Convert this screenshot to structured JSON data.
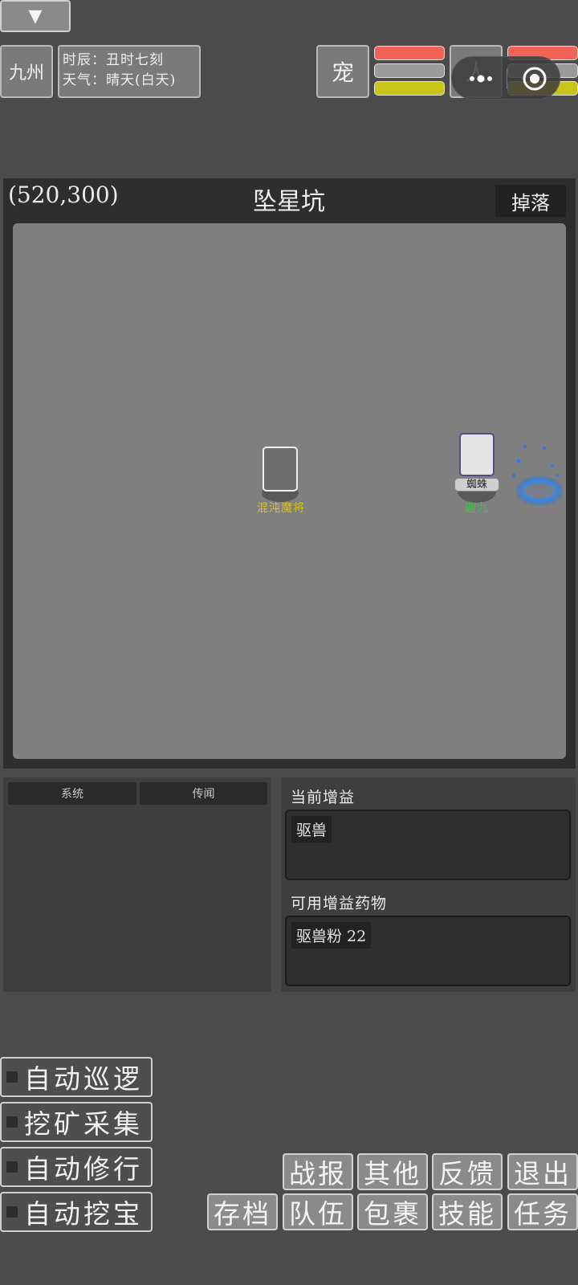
{
  "header": {
    "region": "九州",
    "time_line": "时辰：丑时七刻",
    "weather_line": "天气：晴天(白天)",
    "pet_label": "宠",
    "person_label": "人",
    "pet_bars": {
      "hp": 1.0,
      "mp": 1.0,
      "exp": 1.0
    },
    "person_bars": {
      "hp": 1.0,
      "mp": 1.0,
      "exp": 1.0
    },
    "bar_colors": {
      "hp": "#f26457",
      "mp": "#9a9a9a",
      "exp": "#c8c41c"
    }
  },
  "mini_program": {
    "more_icon": "more-dots-icon",
    "close_icon": "target-circle-icon"
  },
  "map": {
    "coords": "(520,300)",
    "name": "坠星坑",
    "drop_button": "掉落"
  },
  "entities": [
    {
      "name": "混沌魔将",
      "title": "",
      "name_color": "#d6c21a"
    },
    {
      "name": "迦九",
      "title": "蜘蛛",
      "name_color": "#2fcb3a"
    }
  ],
  "log": {
    "tabs": [
      "系统",
      "传闻"
    ]
  },
  "buffs": {
    "current_title": "当前增益",
    "current": [
      "驱兽"
    ],
    "available_title": "可用增益药物",
    "available": [
      "驱兽粉 22"
    ]
  },
  "auto": {
    "patrol": "自动巡逻",
    "mining": "挖矿采集",
    "cultivate": "自动修行",
    "treasure": "自动挖宝"
  },
  "actions": {
    "collapse": "▼",
    "row1": [
      "战报",
      "其他",
      "反馈",
      "退出"
    ],
    "row2": [
      "存档",
      "队伍",
      "包裹",
      "技能",
      "任务"
    ]
  }
}
